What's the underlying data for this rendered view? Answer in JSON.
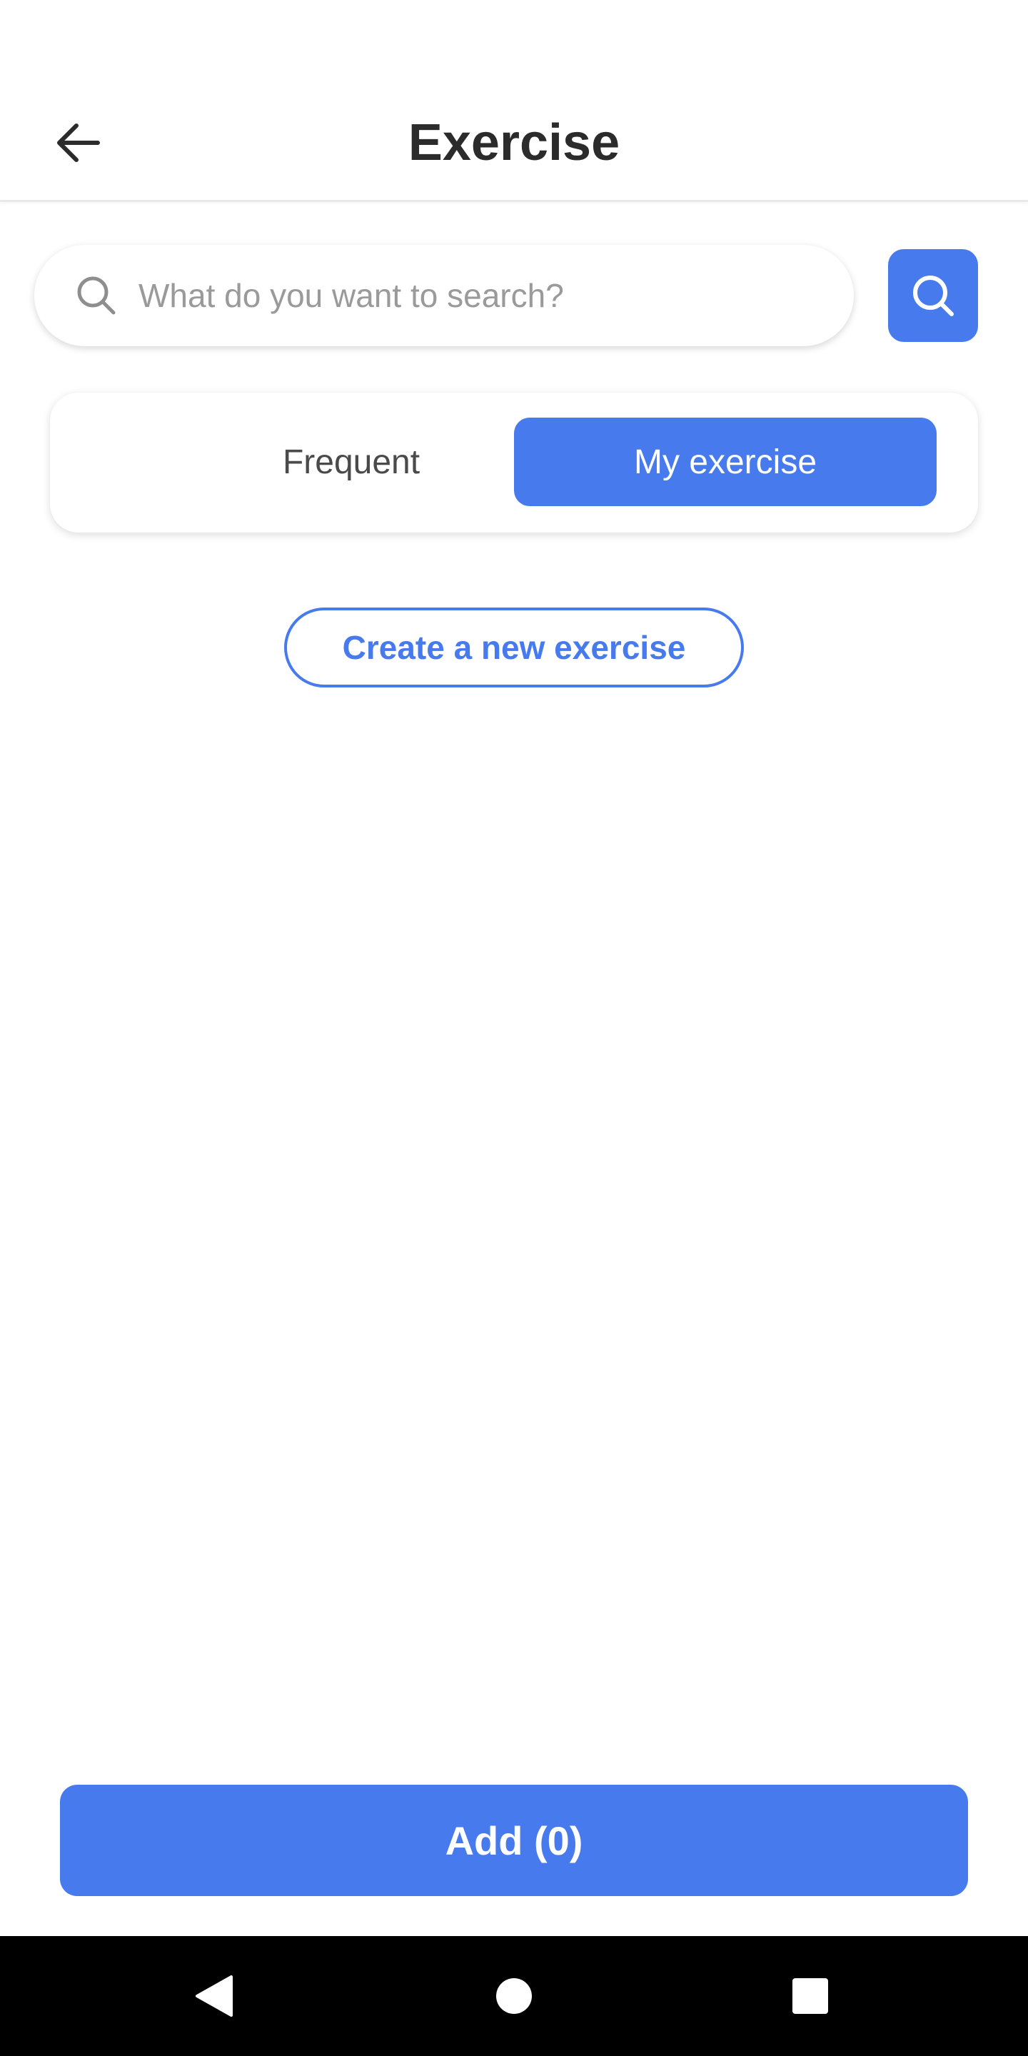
{
  "header": {
    "title": "Exercise",
    "back_icon": "arrow-left-icon"
  },
  "search": {
    "placeholder": "What do you want to search?",
    "value": "",
    "icon": "search-icon",
    "button_icon": "search-icon"
  },
  "tabs": [
    {
      "label": "Frequent",
      "active": false
    },
    {
      "label": "My exercise",
      "active": true
    }
  ],
  "create_label": "Create a new exercise",
  "add_label": "Add (0)",
  "nav": {
    "back_icon": "triangle-back-icon",
    "home_icon": "circle-home-icon",
    "recents_icon": "square-recents-icon"
  },
  "colors": {
    "accent": "#477bed",
    "title": "#2b2b2b",
    "placeholder": "#9a9a9a",
    "nav_bar": "#000000"
  }
}
